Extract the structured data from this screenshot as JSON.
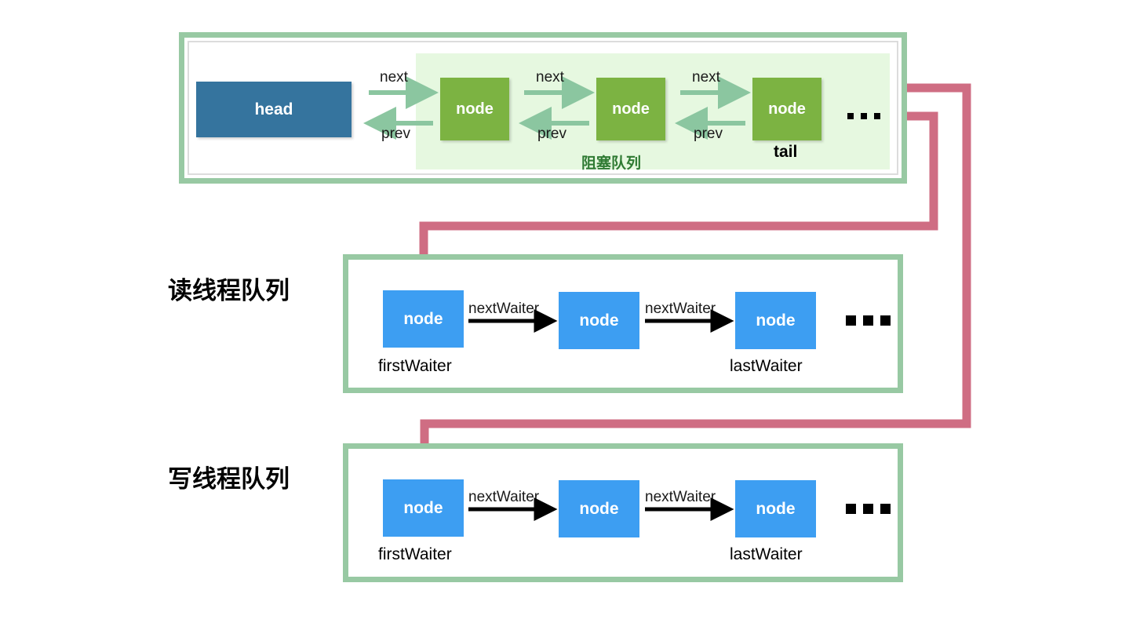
{
  "diagram": {
    "title_top": "阻塞队列",
    "sections": [
      {
        "id": "blocking-queue",
        "band_label": "阻塞队列",
        "head_label": "head",
        "nodes": [
          {
            "label": "node",
            "caption": ""
          },
          {
            "label": "node",
            "caption": ""
          },
          {
            "label": "node",
            "caption": "tail"
          }
        ],
        "edge_forward": "next",
        "edge_backward": "prev",
        "ellipsis": "..."
      },
      {
        "id": "reader-queue",
        "title": "读线程队列",
        "nodes": [
          {
            "label": "node",
            "caption": "firstWaiter"
          },
          {
            "label": "node",
            "caption": ""
          },
          {
            "label": "node",
            "caption": "lastWaiter"
          }
        ],
        "edge_label": "nextWaiter",
        "ellipsis": "..."
      },
      {
        "id": "writer-queue",
        "title": "写线程队列",
        "nodes": [
          {
            "label": "node",
            "caption": "firstWaiter"
          },
          {
            "label": "node",
            "caption": ""
          },
          {
            "label": "node",
            "caption": "lastWaiter"
          }
        ],
        "edge_label": "nextWaiter",
        "ellipsis": "..."
      }
    ],
    "colors": {
      "frame_green": "#98c9a3",
      "band_green": "#e6f8e0",
      "node_green": "#7cb342",
      "head_blue": "#35749e",
      "node_blue": "#3d9ef2",
      "arrow_green": "#8bc6a0",
      "connector_pink": "#cf6d83",
      "band_label_green": "#2f7a33"
    }
  }
}
